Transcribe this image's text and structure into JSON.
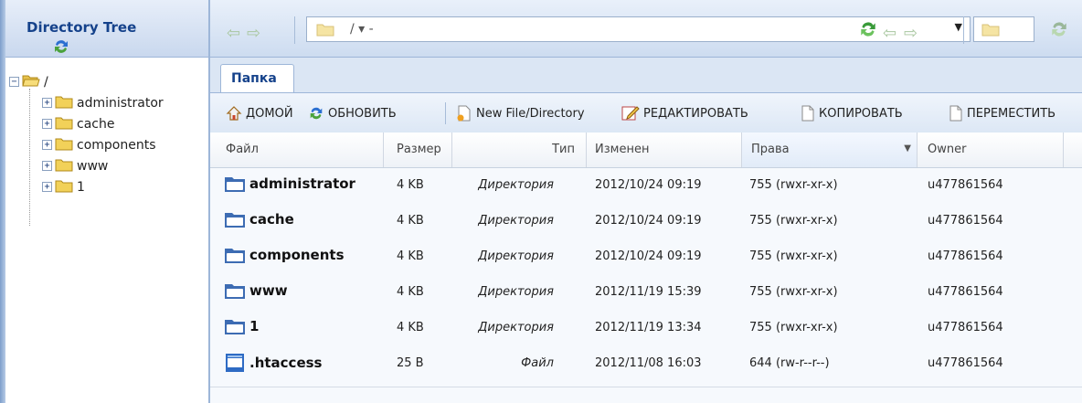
{
  "sidebar": {
    "title": "Directory Tree",
    "root_label": "/",
    "items": [
      {
        "label": "administrator"
      },
      {
        "label": "cache"
      },
      {
        "label": "components"
      },
      {
        "label": "www"
      },
      {
        "label": "1"
      }
    ]
  },
  "topbar": {
    "path": "/ ▾ -"
  },
  "tabs": [
    {
      "label": "Папка"
    }
  ],
  "toolbar": {
    "home_label": "ДОМОЙ",
    "refresh_label": "ОБНОВИТЬ",
    "new_label": "New File/Directory",
    "edit_label": "РЕДАКТИРОВАТЬ",
    "copy_label": "КОПИРОВАТЬ",
    "move_label": "ПЕРЕМЕСТИТЬ"
  },
  "table": {
    "headers": {
      "name": "Файл",
      "size": "Размер",
      "type": "Тип",
      "modified": "Изменен",
      "perms": "Права",
      "owner": "Owner"
    },
    "rows": [
      {
        "name": "administrator",
        "size": "4 KB",
        "type": "Директория",
        "modified": "2012/10/24 09:19",
        "perms": "755 (rwxr-xr-x)",
        "owner": "u477861564",
        "icon": "folder-icon"
      },
      {
        "name": "cache",
        "size": "4 KB",
        "type": "Директория",
        "modified": "2012/10/24 09:19",
        "perms": "755 (rwxr-xr-x)",
        "owner": "u477861564",
        "icon": "folder-icon"
      },
      {
        "name": "components",
        "size": "4 KB",
        "type": "Директория",
        "modified": "2012/10/24 09:19",
        "perms": "755 (rwxr-xr-x)",
        "owner": "u477861564",
        "icon": "folder-icon"
      },
      {
        "name": "www",
        "size": "4 KB",
        "type": "Директория",
        "modified": "2012/11/19 15:39",
        "perms": "755 (rwxr-xr-x)",
        "owner": "u477861564",
        "icon": "folder-icon"
      },
      {
        "name": "1",
        "size": "4 KB",
        "type": "Директория",
        "modified": "2012/11/19 13:34",
        "perms": "755 (rwxr-xr-x)",
        "owner": "u477861564",
        "icon": "folder-icon"
      },
      {
        "name": ".htaccess",
        "size": "25 B",
        "type": "Файл",
        "modified": "2012/11/08 16:03",
        "perms": "644 (rw-r--r--)",
        "owner": "u477861564",
        "icon": "file-icon"
      }
    ]
  },
  "colors": {
    "header_blue": "#15428b",
    "folder_blue": "#3d6cb3",
    "tree_folder": "#f2d159"
  }
}
